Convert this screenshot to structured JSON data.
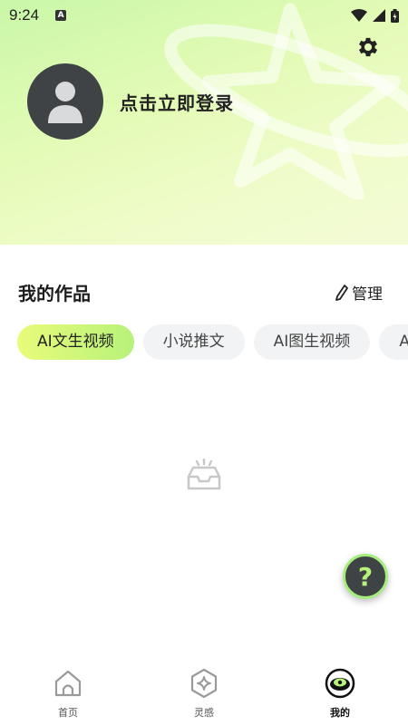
{
  "status_bar": {
    "time": "9:24",
    "notification_icon": "A"
  },
  "profile": {
    "login_prompt": "点击立即登录"
  },
  "works": {
    "title": "我的作品",
    "manage_label": "管理",
    "tabs": [
      {
        "label": "AI文生视频",
        "active": true
      },
      {
        "label": "小说推文",
        "active": false
      },
      {
        "label": "AI图生视频",
        "active": false
      },
      {
        "label": "AI",
        "active": false
      }
    ]
  },
  "help": {
    "label": "?"
  },
  "bottom_nav": {
    "items": [
      {
        "label": "首页",
        "icon": "home-icon",
        "active": false
      },
      {
        "label": "灵感",
        "icon": "inspiration-icon",
        "active": false
      },
      {
        "label": "我的",
        "icon": "profile-icon",
        "active": true
      }
    ]
  },
  "colors": {
    "accent_green": "#b7f27a",
    "accent_lime": "#e9fb7a",
    "dark": "#3f4346"
  }
}
